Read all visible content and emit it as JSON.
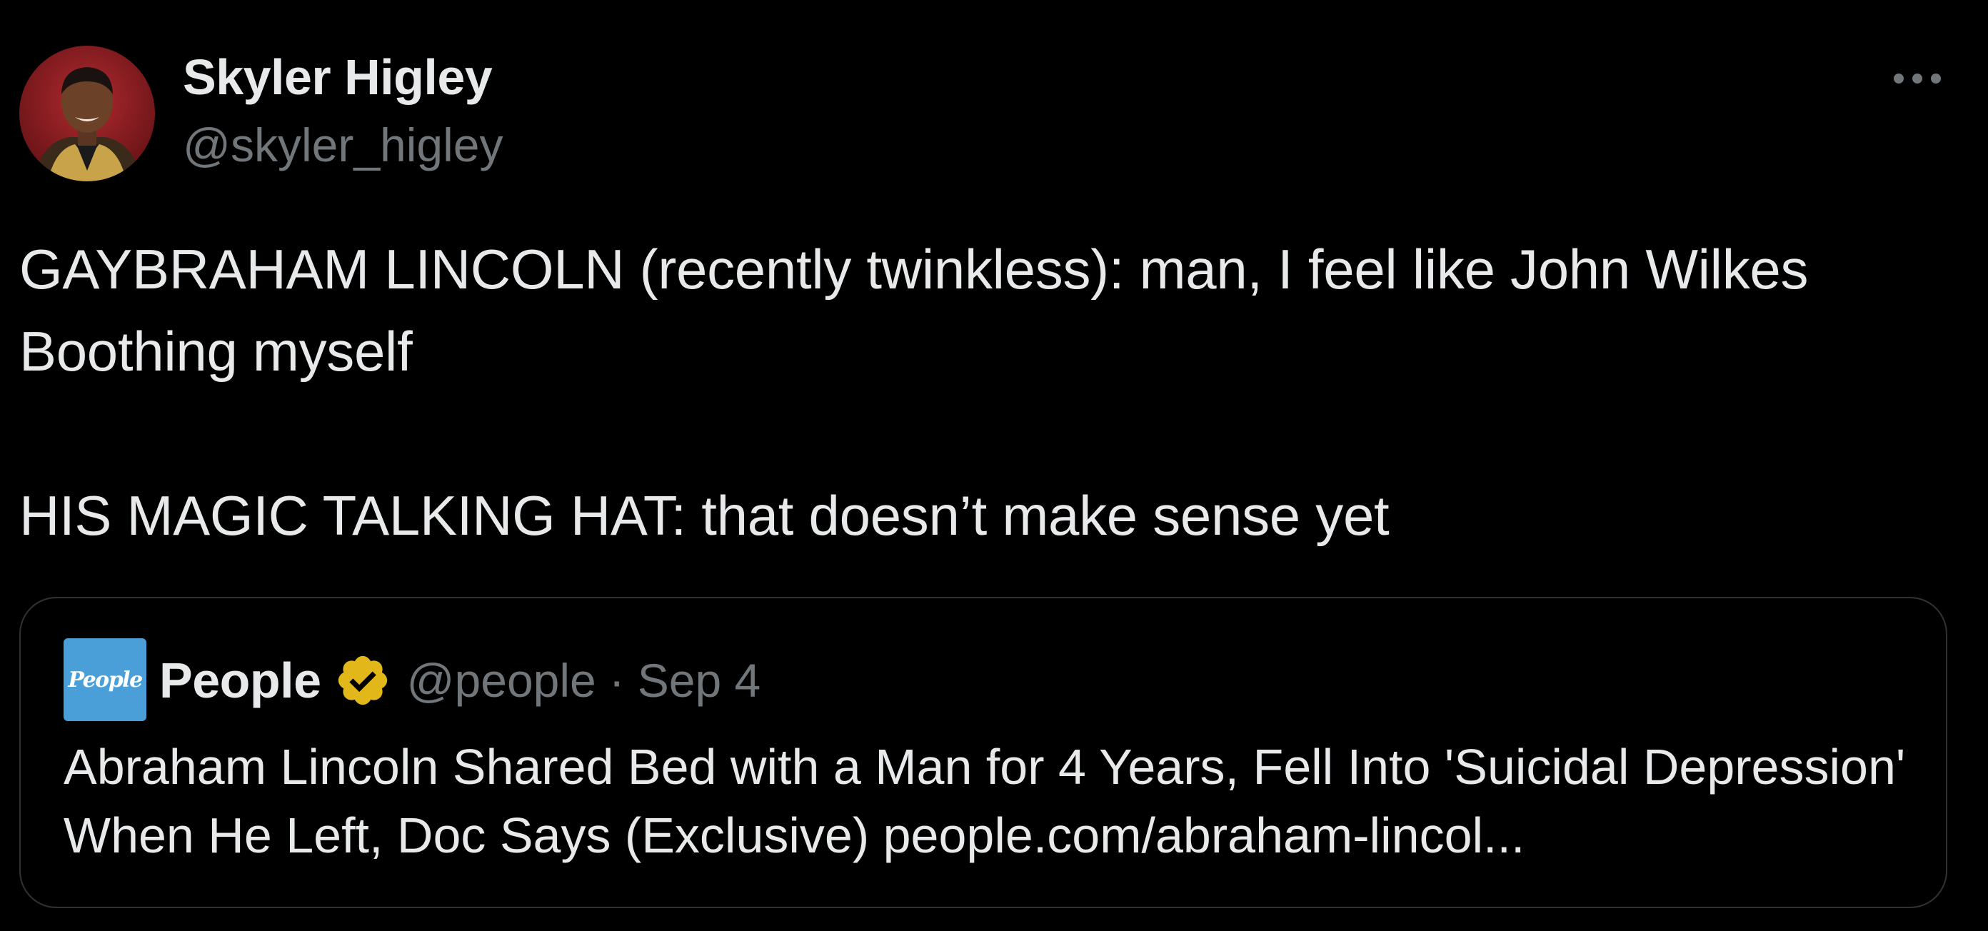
{
  "author": {
    "display_name": "Skyler Higley",
    "handle": "@skyler_higley"
  },
  "tweet": {
    "text": "GAYBRAHAM LINCOLN (recently twinkless): man, I feel like John Wilkes Boothing myself\n\nHIS MAGIC TALKING HAT: that doesn’t make sense yet"
  },
  "more_icon": "more-horizontal-icon",
  "quoted_tweet": {
    "avatar_text": "People",
    "avatar_color": "#4a9fd8",
    "name": "People",
    "verified_icon": "gold-verified-badge-icon",
    "verified_color": "#e2b719",
    "handle": "@people",
    "separator": "·",
    "date": "Sep 4",
    "text": "Abraham Lincoln Shared Bed with a Man for 4 Years, Fell Into 'Suicidal Depression' When He Left, Doc Says (Exclusive) people.com/abraham-lincol..."
  },
  "colors": {
    "background": "#000000",
    "primary_text": "#e7e9ea",
    "secondary_text": "#71767b",
    "border": "#2f3336"
  }
}
